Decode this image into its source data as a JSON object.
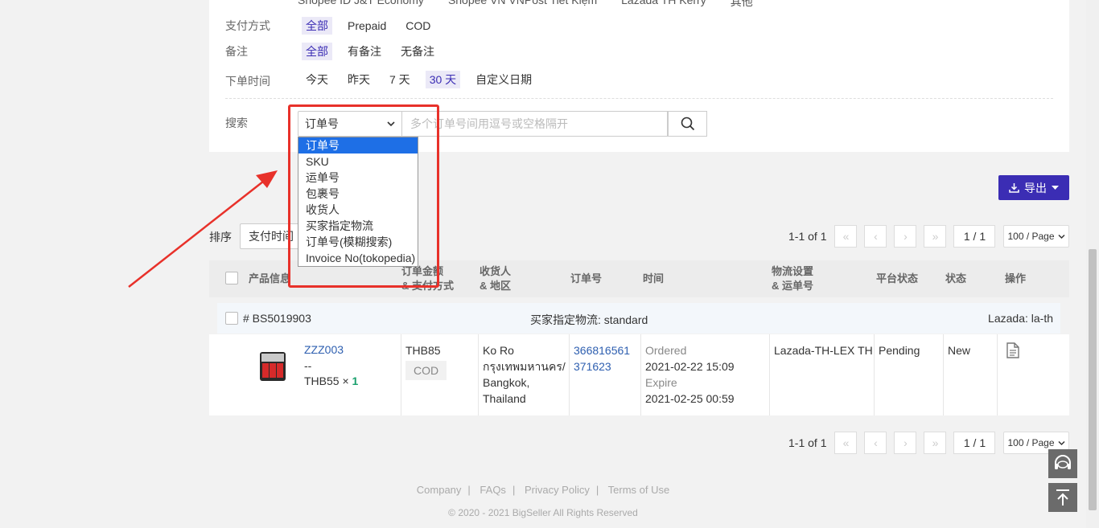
{
  "filters": {
    "trunc_options": [
      "Shopee ID J&T Economy",
      "Shopee VN VNPost Tiết Kiệm",
      "Lazada TH Kerry",
      "其他"
    ],
    "payment": {
      "label": "支付方式",
      "options": [
        "全部",
        "Prepaid",
        "COD"
      ]
    },
    "remark": {
      "label": "备注",
      "options": [
        "全部",
        "有备注",
        "无备注"
      ]
    },
    "order_time": {
      "label": "下单时间",
      "options": [
        "今天",
        "昨天",
        "7 天",
        "30 天",
        "自定义日期"
      ]
    },
    "search": {
      "label": "搜索",
      "selected": "订单号",
      "placeholder": "多个订单号间用逗号或空格隔开",
      "dropdown_options": [
        "订单号",
        "SKU",
        "运单号",
        "包裹号",
        "收货人",
        "买家指定物流",
        "订单号(模糊搜索)",
        "Invoice No(tokopedia)"
      ]
    }
  },
  "toolbar": {
    "export_label": "导出",
    "sort_label": "排序",
    "sort_value": "支付时间"
  },
  "pager": {
    "count": "1-1 of 1",
    "page": "1 / 1",
    "page_size": "100 / Page"
  },
  "table": {
    "headers": {
      "product": "产品信息",
      "amount_1": "订单金额",
      "amount_2": "& 支付方式",
      "receiver_1": "收货人",
      "receiver_2": "& 地区",
      "order_no": "订单号",
      "time": "时间",
      "logistics_1": "物流设置",
      "logistics_2": "& 运单号",
      "platform_status": "平台状态",
      "status": "状态",
      "action": "操作"
    },
    "order": {
      "id": "# BS5019903",
      "buyer_logistics": "买家指定物流: standard",
      "store": "Lazada: la-th",
      "sku": "ZZZ003",
      "variant": "--",
      "price": "THB55",
      "qty_x": "×",
      "qty": "1",
      "amount": "THB85",
      "payment": "COD",
      "receiver_name": "Ko Ro",
      "receiver_region": "กรุงเทพมหานคร/",
      "receiver_city": "Bangkok,",
      "receiver_country": "Thailand",
      "order_no_1": "366816561",
      "order_no_2": "371623",
      "ordered_label": "Ordered",
      "ordered_time": "2021-02-22 15:09",
      "expire_label": "Expire",
      "expire_time": "2021-02-25 00:59",
      "logistics": "Lazada-TH-LEX TH",
      "platform_status": "Pending",
      "status": "New"
    }
  },
  "footer": {
    "links": [
      "Company",
      "FAQs",
      "Privacy Policy",
      "Terms of Use"
    ],
    "copyright": "© 2020 - 2021 BigSeller All Rights Reserved"
  },
  "colors": {
    "accent": "#3b2db4",
    "annotation": "#e8312a",
    "link": "#2e5fb0"
  }
}
